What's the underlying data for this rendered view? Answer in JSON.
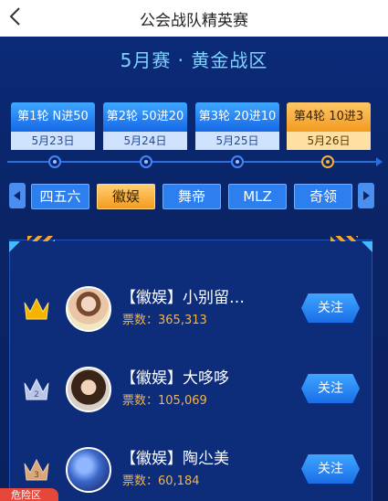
{
  "header": {
    "title": "公会战队精英赛",
    "back_icon": "chevron-left-icon"
  },
  "subtitle": "5月赛 · 黄金战区",
  "rounds": [
    {
      "label": "第1轮 N进50",
      "date": "5月23日",
      "active": false
    },
    {
      "label": "第2轮 50进20",
      "date": "5月24日",
      "active": false
    },
    {
      "label": "第3轮 20进10",
      "date": "5月25日",
      "active": false
    },
    {
      "label": "第4轮 10进3",
      "date": "5月26日",
      "active": true
    }
  ],
  "teams": [
    {
      "label": "四五六",
      "active": false
    },
    {
      "label": "徽娱",
      "active": true
    },
    {
      "label": "舞帝",
      "active": false
    },
    {
      "label": "MLZ",
      "active": false
    },
    {
      "label": "奇领",
      "active": false
    }
  ],
  "ranking": [
    {
      "rank": "1",
      "name": "【徽娱】小别留…",
      "votes": "票数：365,313",
      "follow": "关注",
      "crown_color": "#f5b400"
    },
    {
      "rank": "2",
      "name": "【徽娱】大哆哆",
      "votes": "票数：105,069",
      "follow": "关注",
      "crown_color": "#b9c6e6"
    },
    {
      "rank": "3",
      "name": "【徽娱】陶尐美",
      "votes": "票数：60,184",
      "follow": "关注",
      "crown_color": "#d9a77a"
    }
  ],
  "danger_label": "危险区",
  "colors": {
    "accent": "#2d7ff0",
    "active": "#f49b20",
    "background": "#0d2566",
    "votes": "#f3b44a"
  }
}
